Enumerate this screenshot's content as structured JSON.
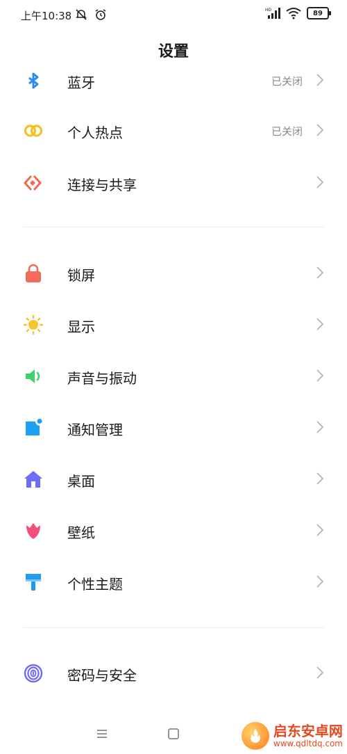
{
  "status": {
    "time": "上午10:38",
    "battery": "89"
  },
  "header": {
    "title": "设置"
  },
  "items": [
    {
      "label": "蓝牙",
      "value": "已关闭",
      "icon": "bluetooth-icon",
      "color": "#2d8cf0"
    },
    {
      "label": "个人热点",
      "value": "已关闭",
      "icon": "hotspot-icon",
      "color": "#f5c226"
    },
    {
      "label": "连接与共享",
      "value": "",
      "icon": "connection-share-icon",
      "color": "#f06a4d"
    },
    {
      "label": "锁屏",
      "value": "",
      "icon": "lock-icon",
      "color": "#f36c5b"
    },
    {
      "label": "显示",
      "value": "",
      "icon": "sun-icon",
      "color": "#f7c331"
    },
    {
      "label": "声音与振动",
      "value": "",
      "icon": "speaker-icon",
      "color": "#3fd16b"
    },
    {
      "label": "通知管理",
      "value": "",
      "icon": "notification-icon",
      "color": "#1aa0f5"
    },
    {
      "label": "桌面",
      "value": "",
      "icon": "home-icon",
      "color": "#6e6cf2"
    },
    {
      "label": "壁纸",
      "value": "",
      "icon": "tulip-icon",
      "color": "#f2517a"
    },
    {
      "label": "个性主题",
      "value": "",
      "icon": "brush-icon",
      "color": "#1e9cf0"
    },
    {
      "label": "密码与安全",
      "value": "",
      "icon": "fingerprint-icon",
      "color": "#6e6cf2"
    }
  ],
  "watermark": {
    "title": "启东安卓网",
    "url": "www.qdltdq.com"
  }
}
